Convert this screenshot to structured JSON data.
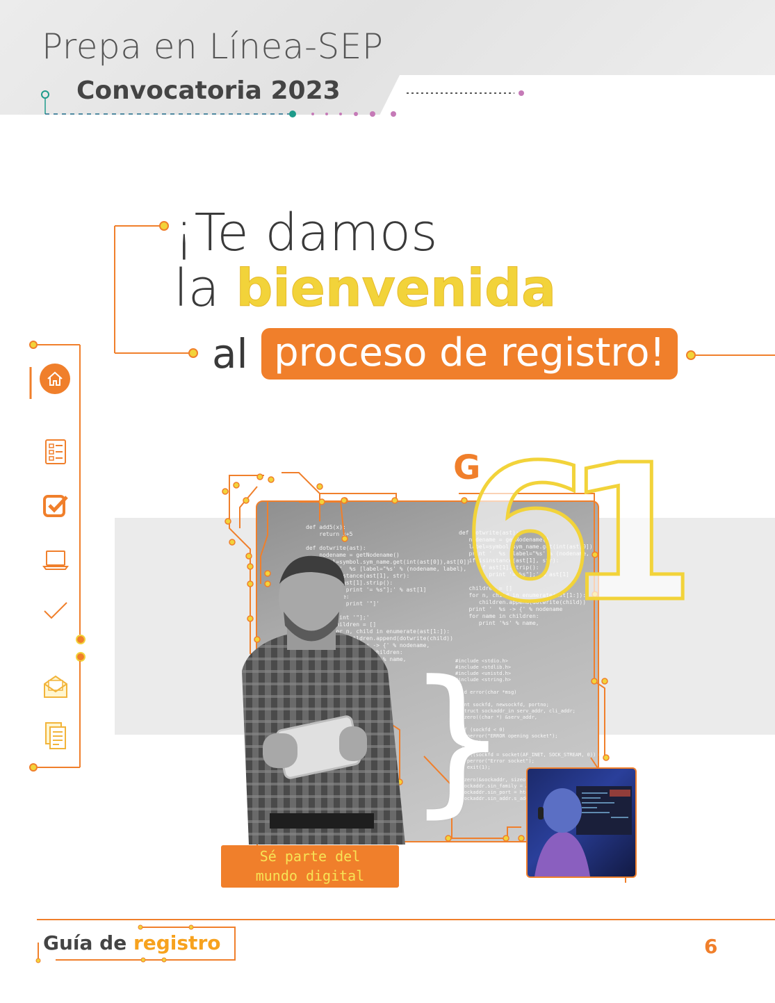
{
  "header": {
    "app_title": "Prepa en Línea-SEP",
    "subtitle": "Convocatoria 2023"
  },
  "hero": {
    "line1": "¡Te damos",
    "line2_prefix": "la",
    "line2_bold": "bienvenida",
    "line3_prefix": "al",
    "line3_pill": "proceso de registro!"
  },
  "sidebar": {
    "items": [
      {
        "icon": "home-icon"
      },
      {
        "icon": "form-icon"
      },
      {
        "icon": "checkbox-icon"
      },
      {
        "icon": "laptop-icon"
      },
      {
        "icon": "checkmark-icon"
      },
      {
        "icon": "email-icon"
      },
      {
        "icon": "document-icon"
      }
    ]
  },
  "collage": {
    "big_letter": "G",
    "big_numbers": "61",
    "cta_line1": "Sé parte del",
    "cta_line2": "mundo digital"
  },
  "footer": {
    "guide_prefix": "Guía de",
    "guide_accent": "registro",
    "page_number": "6"
  },
  "colors": {
    "accent_orange": "#f07f2b",
    "accent_yellow": "#f2d33a",
    "teal": "#1e9b8a"
  }
}
